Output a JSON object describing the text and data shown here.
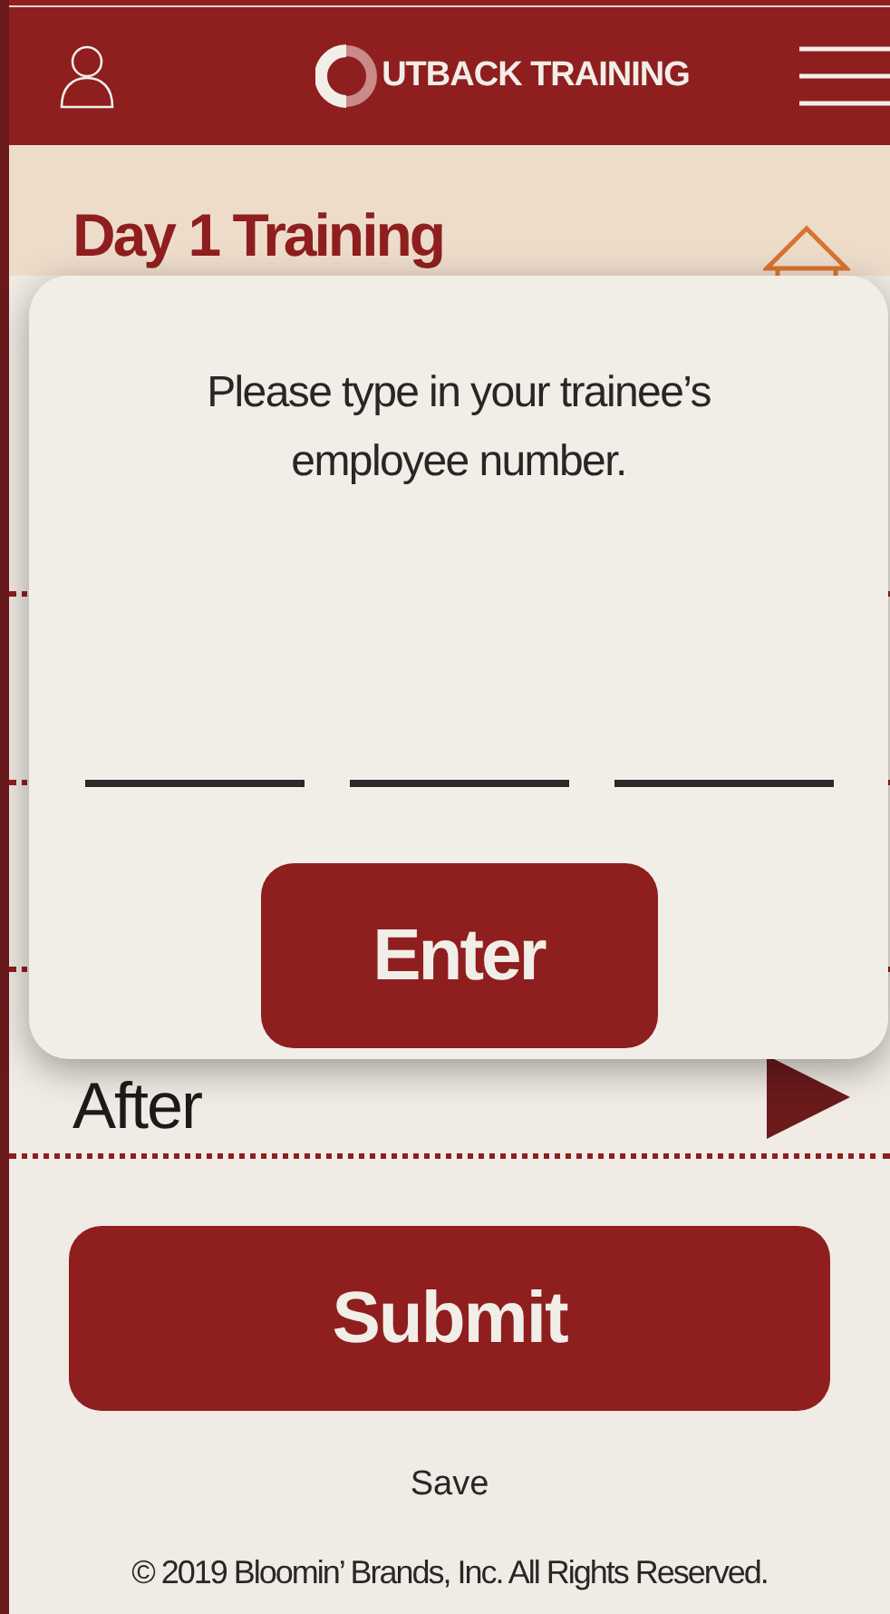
{
  "header": {
    "logo_text": "UTBACK TRAINING"
  },
  "page": {
    "title": "Day 1 Training"
  },
  "rows": [
    {
      "label": "After",
      "expanded": false
    }
  ],
  "dialog": {
    "message": "Please type in your trainee’s employee number.",
    "button": "Enter"
  },
  "submit_button": "Submit",
  "save_link": "Save",
  "footer": "© 2019 Bloomin’ Brands, Inc. All Rights Reserved."
}
